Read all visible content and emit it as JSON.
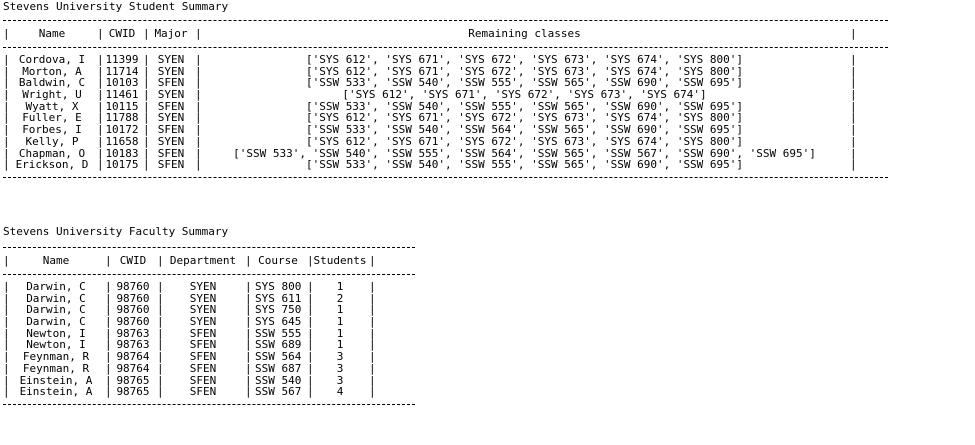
{
  "student_summary": {
    "title": "Stevens University Student Summary",
    "headers": [
      "Name",
      "CWID",
      "Major",
      "Remaining classes"
    ],
    "rows": [
      {
        "name": "Cordova, I",
        "cwid": "11399",
        "major": "SYEN",
        "remaining": "['SYS 612', 'SYS 671', 'SYS 672', 'SYS 673', 'SYS 674', 'SYS 800']"
      },
      {
        "name": "Morton, A",
        "cwid": "11714",
        "major": "SYEN",
        "remaining": "['SYS 612', 'SYS 671', 'SYS 672', 'SYS 673', 'SYS 674', 'SYS 800']"
      },
      {
        "name": "Baldwin, C",
        "cwid": "10103",
        "major": "SFEN",
        "remaining": "['SSW 533', 'SSW 540', 'SSW 555', 'SSW 565', 'SSW 690', 'SSW 695']"
      },
      {
        "name": "Wright, U",
        "cwid": "11461",
        "major": "SYEN",
        "remaining": "['SYS 612', 'SYS 671', 'SYS 672', 'SYS 673', 'SYS 674']"
      },
      {
        "name": "Wyatt, X",
        "cwid": "10115",
        "major": "SFEN",
        "remaining": "['SSW 533', 'SSW 540', 'SSW 555', 'SSW 565', 'SSW 690', 'SSW 695']"
      },
      {
        "name": "Fuller, E",
        "cwid": "11788",
        "major": "SYEN",
        "remaining": "['SYS 612', 'SYS 671', 'SYS 672', 'SYS 673', 'SYS 674', 'SYS 800']"
      },
      {
        "name": "Forbes, I",
        "cwid": "10172",
        "major": "SFEN",
        "remaining": "['SSW 533', 'SSW 540', 'SSW 564', 'SSW 565', 'SSW 690', 'SSW 695']"
      },
      {
        "name": "Kelly, P",
        "cwid": "11658",
        "major": "SYEN",
        "remaining": "['SYS 612', 'SYS 671', 'SYS 672', 'SYS 673', 'SYS 674', 'SYS 800']"
      },
      {
        "name": "Chapman, O",
        "cwid": "10183",
        "major": "SFEN",
        "remaining": "['SSW 533', 'SSW 540', 'SSW 555', 'SSW 564', 'SSW 565', 'SSW 567', 'SSW 690', 'SSW 695']"
      },
      {
        "name": "Erickson, D",
        "cwid": "10175",
        "major": "SFEN",
        "remaining": "['SSW 533', 'SSW 540', 'SSW 555', 'SSW 565', 'SSW 690', 'SSW 695']"
      }
    ]
  },
  "faculty_summary": {
    "title": "Stevens University Faculty Summary",
    "headers": [
      "Name",
      "CWID",
      "Department",
      "Course",
      "Students"
    ],
    "rows": [
      {
        "name": "Darwin, C",
        "cwid": "98760",
        "department": "SYEN",
        "course": "SYS 800",
        "students": "1"
      },
      {
        "name": "Darwin, C",
        "cwid": "98760",
        "department": "SYEN",
        "course": "SYS 611",
        "students": "2"
      },
      {
        "name": "Darwin, C",
        "cwid": "98760",
        "department": "SYEN",
        "course": "SYS 750",
        "students": "1"
      },
      {
        "name": "Darwin, C",
        "cwid": "98760",
        "department": "SYEN",
        "course": "SYS 645",
        "students": "1"
      },
      {
        "name": "Newton, I",
        "cwid": "98763",
        "department": "SFEN",
        "course": "SSW 555",
        "students": "1"
      },
      {
        "name": "Newton, I",
        "cwid": "98763",
        "department": "SFEN",
        "course": "SSW 689",
        "students": "1"
      },
      {
        "name": "Feynman, R",
        "cwid": "98764",
        "department": "SFEN",
        "course": "SSW 564",
        "students": "3"
      },
      {
        "name": "Feynman, R",
        "cwid": "98764",
        "department": "SFEN",
        "course": "SSW 687",
        "students": "3"
      },
      {
        "name": "Einstein, A",
        "cwid": "98765",
        "department": "SFEN",
        "course": "SSW 540",
        "students": "3"
      },
      {
        "name": "Einstein, A",
        "cwid": "98765",
        "department": "SFEN",
        "course": "SSW 567",
        "students": "4"
      }
    ]
  }
}
